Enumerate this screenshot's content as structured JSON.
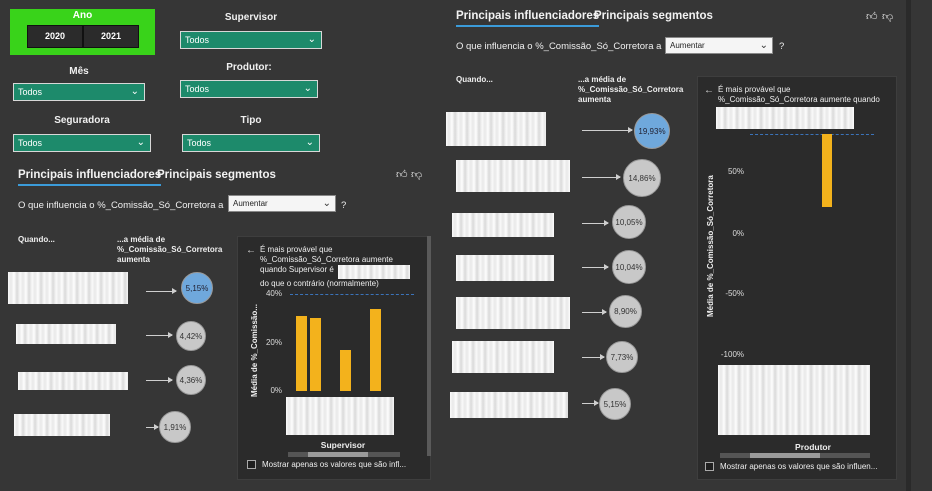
{
  "filters": {
    "ano": {
      "label": "Ano",
      "options": [
        "2020",
        "2021"
      ]
    },
    "supervisor": {
      "label": "Supervisor",
      "value": "Todos"
    },
    "mes": {
      "label": "Mês",
      "value": "Todos"
    },
    "produtor": {
      "label": "Produtor:",
      "value": "Todos"
    },
    "seguradora": {
      "label": "Seguradora",
      "value": "Todos"
    },
    "tipo": {
      "label": "Tipo",
      "value": "Todos"
    }
  },
  "left_visual": {
    "tab_influencers": "Principais influenciadores",
    "tab_segments": "Principais segmentos",
    "question": "O que influencia o %_Comissão_Só_Corretora a",
    "dropdown_value": "Aumentar",
    "help": "?",
    "col_when": "Quando...",
    "col_avg": "...a média de %_Comissão_Só_Corretora aumenta",
    "bubbles": [
      "5,15%",
      "4,42%",
      "4,36%",
      "1,91%"
    ],
    "detail_title": "É mais provável que %_Comissão_Só_Corretora aumente quando Supervisor é",
    "detail_title_cont": "do que o contrário (normalmente)",
    "y_axis_label": "Média de %_Comissão...",
    "y_ticks": [
      "40%",
      "20%",
      "0%"
    ],
    "x_axis_label": "Supervisor",
    "checkbox_label": "Mostrar apenas os valores que são infl..."
  },
  "right_visual": {
    "tab_influencers": "Principais influenciadores",
    "tab_segments": "Principais segmentos",
    "question": "O que influencia o %_Comissão_Só_Corretora a",
    "dropdown_value": "Aumentar",
    "help": "?",
    "col_when": "Quando...",
    "col_avg": "...a média de %_Comissão_Só_Corretora aumenta",
    "bubbles": [
      "19,93%",
      "14,86%",
      "10,05%",
      "10,04%",
      "8,90%",
      "7,73%",
      "5,15%"
    ],
    "detail_title": "É mais provável que %_Comissão_Só_Corretora aumente quando",
    "y_axis_label": "Média de %_Comissão_Só_Corretora",
    "y_ticks": [
      "50%",
      "0%",
      "-50%",
      "-100%"
    ],
    "x_axis_label": "Produtor",
    "checkbox_label": "Mostrar apenas os valores que são influen..."
  },
  "chart_data": [
    {
      "type": "bar",
      "xlabel": "Supervisor",
      "ylabel": "Média de %_Comissão...",
      "ylim": [
        0,
        40
      ],
      "values": [
        31,
        30,
        17,
        34
      ],
      "average_line": 40
    },
    {
      "type": "bar",
      "xlabel": "Produtor",
      "ylabel": "Média de %_Comissão_Só_Corretora",
      "ylim": [
        -100,
        50
      ],
      "values": [
        50
      ],
      "average_line": 80
    }
  ],
  "colors": {
    "accent": "#3b9bd9",
    "slicer": "#1d8a6b",
    "bar": "#f3b21c",
    "top_bubble": "#6fa8dc",
    "year_bg": "#39d31a"
  }
}
